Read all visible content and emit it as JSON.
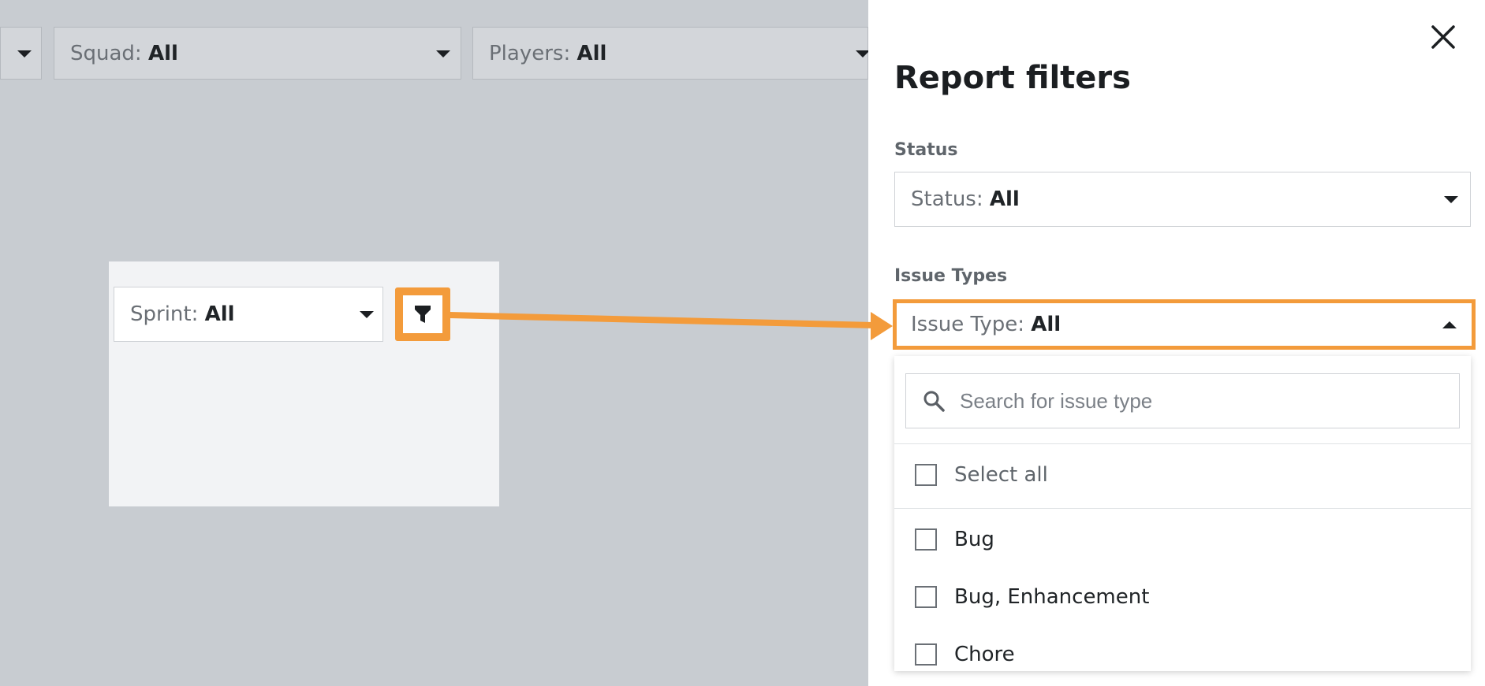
{
  "top_filters": [
    {
      "label": "Squad:",
      "value": "All"
    },
    {
      "label": "Players:",
      "value": "All"
    }
  ],
  "card": {
    "sprint_label": "Sprint:",
    "sprint_value": "All",
    "filter_icon": "filter-icon"
  },
  "panel": {
    "title": "Report filters",
    "close_icon": "close-icon",
    "status_section": "Status",
    "status_label": "Status:",
    "status_value": "All",
    "issue_section": "Issue Types",
    "issue_label": "Issue Type:",
    "issue_value": "All",
    "search_placeholder": "Search for issue type",
    "select_all": "Select all",
    "options": [
      "Bug",
      "Bug, Enhancement",
      "Chore"
    ]
  },
  "colors": {
    "highlight": "#f39b3b",
    "overlay": "#c8ccd1"
  }
}
